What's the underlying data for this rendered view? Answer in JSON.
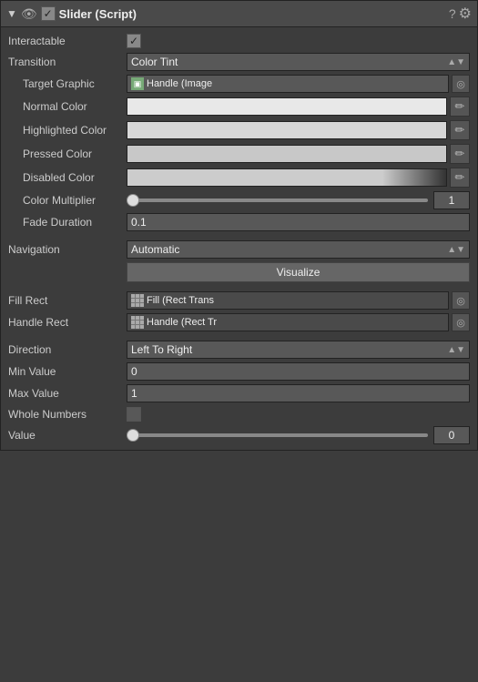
{
  "panel": {
    "title": "Slider (Script)",
    "interactable_label": "Interactable",
    "interactable_checked": true,
    "transition_label": "Transition",
    "transition_value": "Color Tint",
    "target_graphic_label": "Target Graphic",
    "target_graphic_value": "Handle (Image",
    "normal_color_label": "Normal Color",
    "highlighted_color_label": "Highlighted Color",
    "pressed_color_label": "Pressed Color",
    "disabled_color_label": "Disabled Color",
    "color_multiplier_label": "Color Multiplier",
    "color_multiplier_value": "1",
    "fade_duration_label": "Fade Duration",
    "fade_duration_value": "0.1",
    "navigation_label": "Navigation",
    "navigation_value": "Automatic",
    "visualize_label": "Visualize",
    "fill_rect_label": "Fill Rect",
    "fill_rect_value": "Fill (Rect Trans",
    "handle_rect_label": "Handle Rect",
    "handle_rect_value": "Handle (Rect Tr",
    "direction_label": "Direction",
    "direction_value": "Left To Right",
    "min_value_label": "Min Value",
    "min_value": "0",
    "max_value_label": "Max Value",
    "max_value": "1",
    "whole_numbers_label": "Whole Numbers",
    "value_label": "Value",
    "value_value": "0"
  }
}
